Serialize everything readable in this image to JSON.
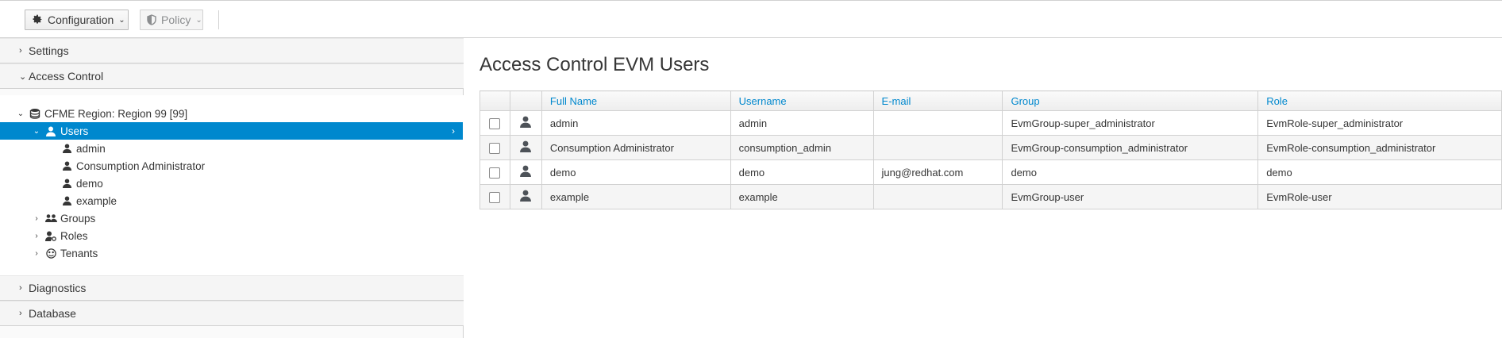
{
  "toolbar": {
    "configuration_label": "Configuration",
    "policy_label": "Policy"
  },
  "sidebar": {
    "accordions": {
      "settings": "Settings",
      "access_control": "Access Control",
      "diagnostics": "Diagnostics",
      "database": "Database"
    },
    "tree": {
      "region": "CFME Region: Region 99 [99]",
      "users": "Users",
      "user_items": [
        "admin",
        "Consumption Administrator",
        "demo",
        "example"
      ],
      "groups": "Groups",
      "roles": "Roles",
      "tenants": "Tenants"
    }
  },
  "main": {
    "title": "Access Control EVM Users",
    "columns": [
      "Full Name",
      "Username",
      "E-mail",
      "Group",
      "Role"
    ],
    "rows": [
      {
        "full_name": "admin",
        "username": "admin",
        "email": "",
        "group": "EvmGroup-super_administrator",
        "role": "EvmRole-super_administrator"
      },
      {
        "full_name": "Consumption Administrator",
        "username": "consumption_admin",
        "email": "",
        "group": "EvmGroup-consumption_administrator",
        "role": "EvmRole-consumption_administrator"
      },
      {
        "full_name": "demo",
        "username": "demo",
        "email": "jung@redhat.com",
        "group": "demo",
        "role": "demo"
      },
      {
        "full_name": "example",
        "username": "example",
        "email": "",
        "group": "EvmGroup-user",
        "role": "EvmRole-user"
      }
    ]
  },
  "colors": {
    "accent": "#0088ce",
    "border": "#d1d1d1"
  }
}
